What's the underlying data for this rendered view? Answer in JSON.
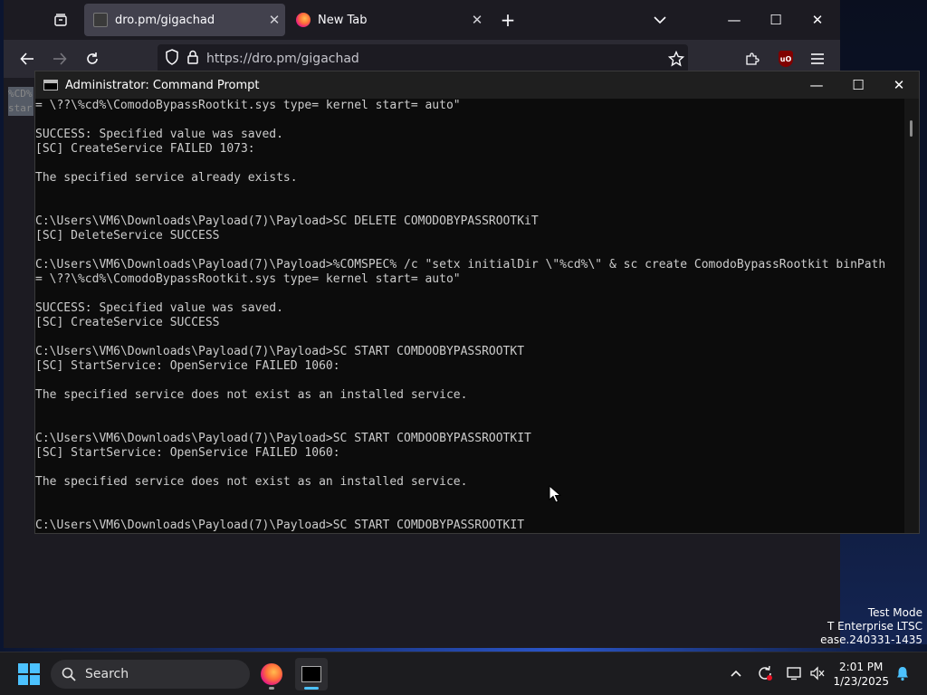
{
  "browser": {
    "tabs": [
      {
        "title": "dro.pm/gigachad",
        "active": true,
        "favicon": "dro-favicon"
      },
      {
        "title": "New Tab",
        "active": false,
        "favicon": "firefox-icon"
      }
    ],
    "url": "https://dro.pm/gigachad",
    "icons": {
      "tab_list": "tab-list-icon",
      "new_tab": "plus-icon",
      "list_all_tabs": "chevron-down-icon",
      "back": "arrow-left-icon",
      "forward": "arrow-right-icon",
      "reload": "reload-icon",
      "tracking": "shield-icon",
      "lock": "lock-icon",
      "bookmark": "star-icon",
      "extensions": "puzzle-icon",
      "ublock": "ublock-origin-icon",
      "menu": "hamburger-icon"
    },
    "page_selected_text": [
      "%CD%",
      "star"
    ]
  },
  "cmd": {
    "title": "Administrator: Command Prompt",
    "lines": [
      "= \\??\\%cd%\\ComodoBypassRootkit.sys type= kernel start= auto\"",
      "",
      "SUCCESS: Specified value was saved.",
      "[SC] CreateService FAILED 1073:",
      "",
      "The specified service already exists.",
      "",
      "",
      "C:\\Users\\VM6\\Downloads\\Payload(7)\\Payload>SC DELETE COMODOBYPASSROOTKiT",
      "[SC] DeleteService SUCCESS",
      "",
      "C:\\Users\\VM6\\Downloads\\Payload(7)\\Payload>%COMSPEC% /c \"setx initialDir \\\"%cd%\\\" & sc create ComodoBypassRootkit binPath",
      "= \\??\\%cd%\\ComodoBypassRootkit.sys type= kernel start= auto\"",
      "",
      "SUCCESS: Specified value was saved.",
      "[SC] CreateService SUCCESS",
      "",
      "C:\\Users\\VM6\\Downloads\\Payload(7)\\Payload>SC START COMDOOBYPASSROOTKT",
      "[SC] StartService: OpenService FAILED 1060:",
      "",
      "The specified service does not exist as an installed service.",
      "",
      "",
      "C:\\Users\\VM6\\Downloads\\Payload(7)\\Payload>SC START COMDOOBYPASSROOTKIT",
      "[SC] StartService: OpenService FAILED 1060:",
      "",
      "The specified service does not exist as an installed service.",
      "",
      "",
      "C:\\Users\\VM6\\Downloads\\Payload(7)\\Payload>SC START COMDOBYPASSROOTKIT"
    ]
  },
  "desktop": {
    "watermark": [
      "Test Mode",
      "T Enterprise LTSC",
      "ease.240331-1435"
    ]
  },
  "taskbar": {
    "search_label": "Search",
    "time": "2:01 PM",
    "date": "1/23/2025",
    "apps": [
      "firefox-icon",
      "command-prompt-icon"
    ],
    "tray": [
      "chevron-up-icon",
      "sync-icon",
      "network-icon",
      "volume-muted-icon",
      "bell-icon"
    ]
  },
  "colors": {
    "cmd_text": "#cccccc",
    "cmd_bg": "#0c0c0c",
    "ff_bg": "#1c1b22",
    "accent": "#4cc2ff"
  }
}
